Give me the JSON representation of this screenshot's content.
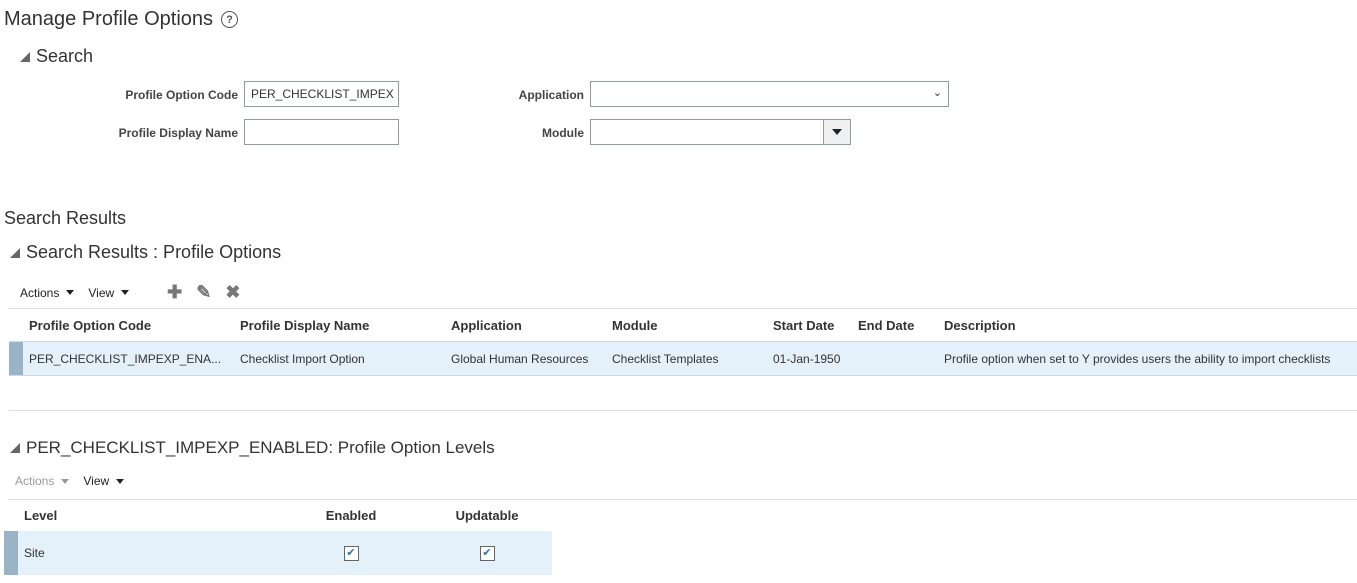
{
  "page": {
    "title": "Manage Profile Options",
    "help": "?"
  },
  "search": {
    "heading": "Search",
    "profile_option_code_label": "Profile Option Code",
    "profile_option_code_value": "PER_CHECKLIST_IMPEX",
    "profile_display_name_label": "Profile Display Name",
    "profile_display_name_value": "",
    "application_label": "Application",
    "application_value": "",
    "module_label": "Module",
    "module_value": ""
  },
  "results": {
    "heading": "Search Results",
    "sub_heading": "Search Results : Profile Options",
    "toolbar": {
      "actions": "Actions",
      "view": "View"
    },
    "columns": [
      "Profile Option Code",
      "Profile Display Name",
      "Application",
      "Module",
      "Start Date",
      "End Date",
      "Description"
    ],
    "rows": [
      [
        "PER_CHECKLIST_IMPEXP_ENA...",
        "Checklist Import Option",
        "Global Human Resources",
        "Checklist Templates",
        "01-Jan-1950",
        "",
        "Profile option when set to Y provides users the ability to import checklists"
      ]
    ]
  },
  "levels": {
    "heading": "PER_CHECKLIST_IMPEXP_ENABLED: Profile Option Levels",
    "toolbar": {
      "actions": "Actions",
      "view": "View"
    },
    "columns": [
      "Level",
      "Enabled",
      "Updatable"
    ],
    "rows": [
      {
        "level": "Site",
        "enabled": true,
        "updatable": true
      }
    ]
  }
}
